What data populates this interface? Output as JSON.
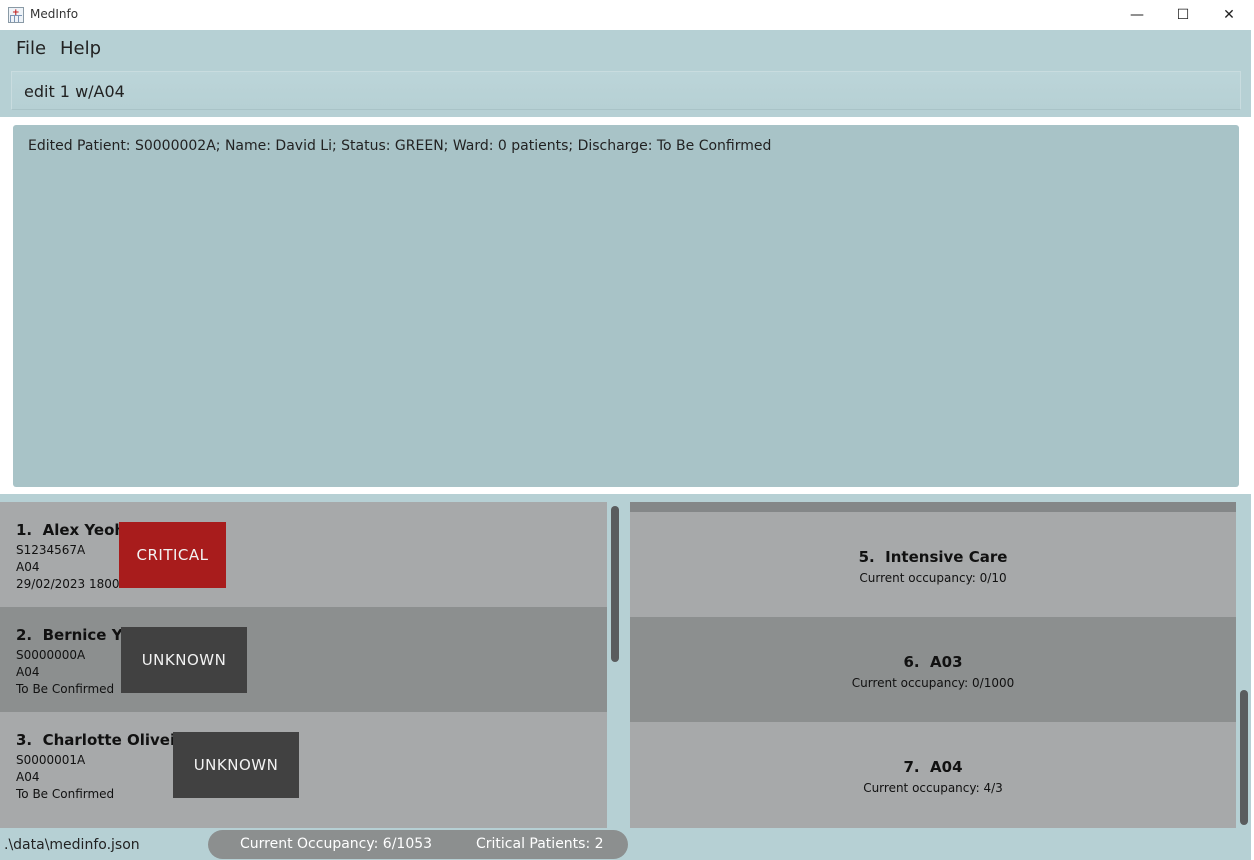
{
  "window": {
    "title": "MedInfo",
    "controls": {
      "minimize": "—",
      "maximize": "☐",
      "close": "✕"
    }
  },
  "menu": {
    "file": "File",
    "help": "Help"
  },
  "command_box": {
    "value": "edit 1 w/A04"
  },
  "result_display": {
    "text": "Edited Patient: S0000002A; Name: David Li; Status: GREEN; Ward: 0 patients; Discharge: To Be Confirmed"
  },
  "patients": [
    {
      "index": "1.",
      "name": "Alex Yeoh",
      "nric": "S1234567A",
      "ward": "A04",
      "discharge": "29/02/2023 1800",
      "status": "CRITICAL"
    },
    {
      "index": "2.",
      "name": "Bernice Yu",
      "nric": "S0000000A",
      "ward": "A04",
      "discharge": "To Be Confirmed",
      "status": "UNKNOWN"
    },
    {
      "index": "3.",
      "name": "Charlotte Oliveiro",
      "nric": "S0000001A",
      "ward": "A04",
      "discharge": "To Be Confirmed",
      "status": "UNKNOWN"
    }
  ],
  "wards": [
    {
      "index": "5.",
      "name": "Intensive Care",
      "occupancy": "Current occupancy: 0/10"
    },
    {
      "index": "6.",
      "name": "A03",
      "occupancy": "Current occupancy: 0/1000"
    },
    {
      "index": "7.",
      "name": "A04",
      "occupancy": "Current occupancy: 4/3"
    }
  ],
  "status_bar": {
    "file_path": ".\\data\\medinfo.json",
    "current_occupancy": "Current Occupancy: 6/1053",
    "critical_patients": "Critical Patients: 2"
  },
  "colors": {
    "critical": "#a81c1c",
    "unknown": "#414141",
    "accent": "#b6d0d4"
  },
  "icons": {
    "app": "medinfo-app-icon"
  }
}
